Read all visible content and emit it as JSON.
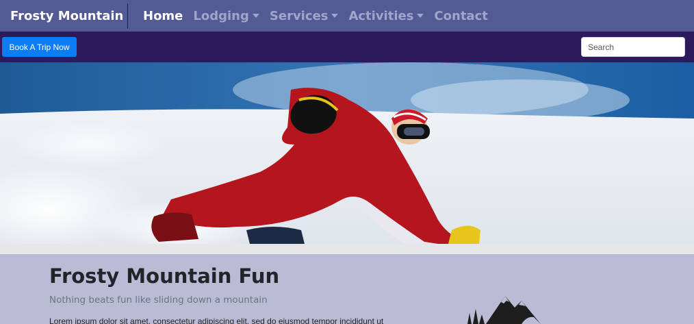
{
  "nav": {
    "brand": "Frosty Mountain",
    "items": [
      {
        "label": "Home",
        "active": true,
        "dropdown": false
      },
      {
        "label": "Lodging",
        "active": false,
        "dropdown": true
      },
      {
        "label": "Services",
        "active": false,
        "dropdown": true
      },
      {
        "label": "Activities",
        "active": false,
        "dropdown": true
      },
      {
        "label": "Contact",
        "active": false,
        "dropdown": false
      }
    ]
  },
  "subbar": {
    "book_label": "Book A Trip Now",
    "search_placeholder": "Search"
  },
  "hero": {
    "image": "skier-carving-snow-photo"
  },
  "main": {
    "title": "Frosty Mountain Fun",
    "subtitle": "Nothing beats fun like sliding down a mountain",
    "paragraph": "Lorem ipsum dolor sit amet, consectetur adipiscing elit, sed do eiusmod tempor incididunt ut",
    "logo": "mountain-logo"
  },
  "colors": {
    "nav_bg": "#525b93",
    "subbar_bg": "#2d1a5d",
    "button_bg": "#0d7cf7",
    "content_bg": "#b9bcd4"
  }
}
